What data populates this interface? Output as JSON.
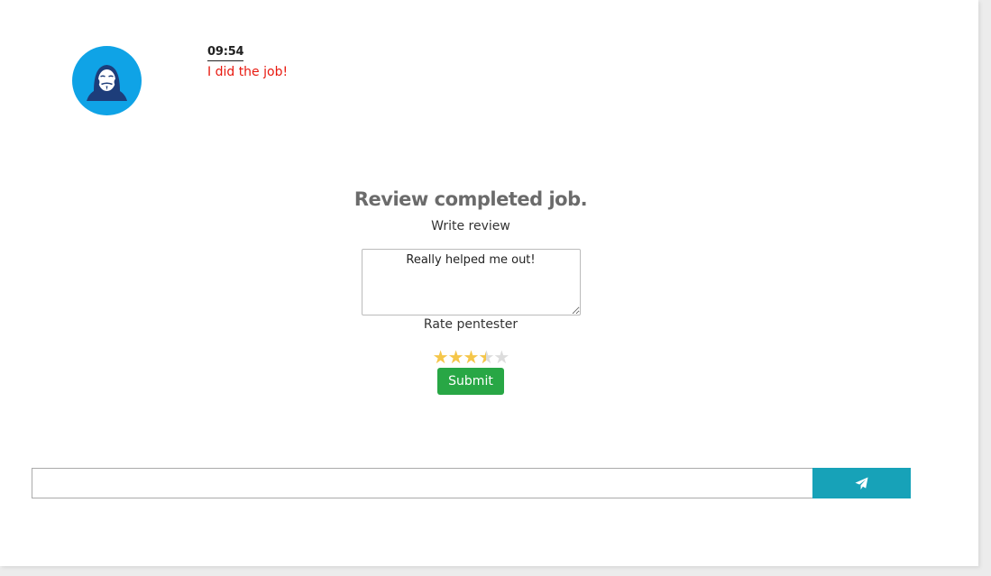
{
  "message": {
    "avatar_icon": "anonymous-hacker-icon",
    "avatar_color": "#0fa3e6",
    "time": "09:54",
    "text": "I did the job!",
    "text_color": "#e8190f"
  },
  "review": {
    "title": "Review completed job.",
    "write_label": "Write review",
    "review_text": "Really helped me out!",
    "rate_label": "Rate pentester",
    "rating": 3.5,
    "rating_max": 5,
    "submit_label": "Submit",
    "submit_color": "#28a745"
  },
  "chat_input": {
    "value": "",
    "send_icon": "paper-plane-icon",
    "send_color": "#17a2b8"
  }
}
